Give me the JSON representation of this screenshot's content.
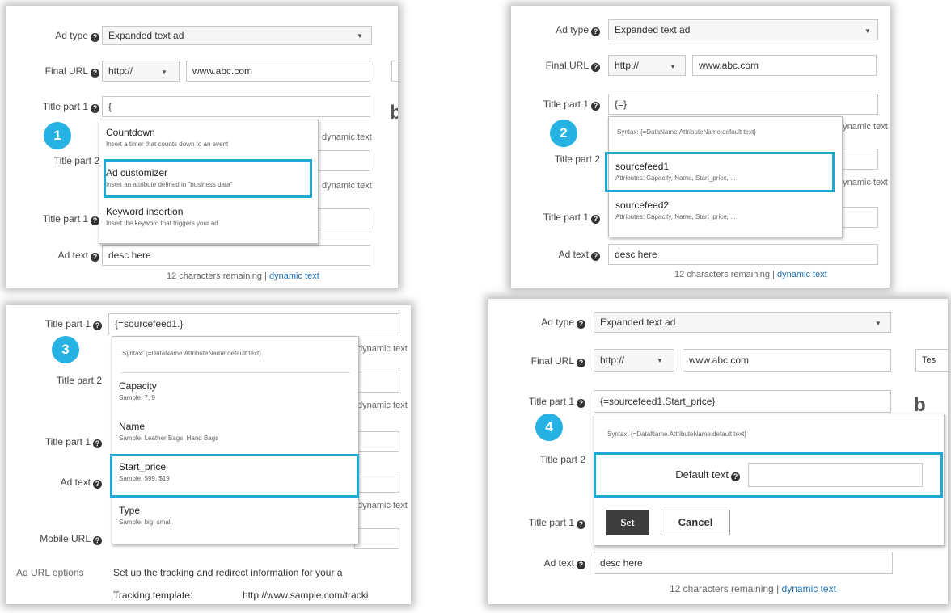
{
  "colors": {
    "highlight": "#21a9d5",
    "step_badge": "#26b2e2",
    "link": "#1a6fb5"
  },
  "icons": {
    "help": "question-circle-icon",
    "dropdown": "chevron-down-icon"
  },
  "labels": {
    "ad_type": "Ad type",
    "final_url": "Final URL",
    "title_part_1": "Title part 1",
    "title_part_2": "Title part 2",
    "ad_text": "Ad text",
    "mobile_url": "Mobile URL",
    "ad_url_options": "Ad URL options",
    "tracking_template": "Tracking template:",
    "dynamic_text": "dynamic text",
    "chars_remaining": "12 characters remaining",
    "separator": "|",
    "help_glyph": "?",
    "caret": "▼"
  },
  "values": {
    "ad_type": "Expanded text ad",
    "protocol": "http://",
    "domain": "www.abc.com",
    "ad_text": "desc here",
    "tracking_url": "http://www.sample.com/tracki",
    "ad_url_options_desc": "Set up the tracking and redirect information for your a"
  },
  "panel1": {
    "step": "1",
    "title_value": "{",
    "options": [
      {
        "title": "Countdown",
        "desc": "Insert a timer that counts down to an event"
      },
      {
        "title": "Ad customizer",
        "desc": "Insert an attribute defined in \"business data\""
      },
      {
        "title": "Keyword insertion",
        "desc": "Insert the keyword that triggers your ad"
      }
    ],
    "highlighted_index": 1
  },
  "panel2": {
    "step": "2",
    "title_value": "{=}",
    "syntax": "Syntax: {=DataName.AttributeName:default text}",
    "options": [
      {
        "title": "sourcefeed1",
        "desc": "Attributes: Capacity, Name, Start_price, ..."
      },
      {
        "title": "sourcefeed2",
        "desc": "Attributes: Capacity, Name, Start_price, ..."
      }
    ],
    "highlighted_index": 0
  },
  "panel3": {
    "step": "3",
    "title_value": "{=sourcefeed1.}",
    "syntax": "Syntax: {=DataName.AttributeName:default text}",
    "options": [
      {
        "title": "Capacity",
        "desc": "Sample: 7, 9"
      },
      {
        "title": "Name",
        "desc": "Sample: Leather Bags, Hand Bags"
      },
      {
        "title": "Start_price",
        "desc": "Sample: $99, $19"
      },
      {
        "title": "Type",
        "desc": "Sample: big, small"
      }
    ],
    "highlighted_index": 2
  },
  "panel4": {
    "step": "4",
    "title_value": "{=sourcefeed1.Start_price}",
    "syntax": "Syntax: {=DataName.AttributeName:default text}",
    "default_text_label": "Default text",
    "default_text_value": "",
    "set_label": "Set",
    "cancel_label": "Cancel",
    "cut_button": "Tes"
  }
}
